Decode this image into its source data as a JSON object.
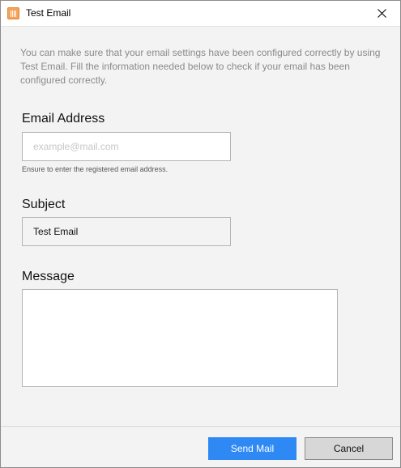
{
  "window": {
    "title": "Test Email",
    "close_icon": "close-icon"
  },
  "intro_text": "You can make sure that your email settings have been configured correctly by using Test Email. Fill the information needed below to check if your email has been configured correctly.",
  "email": {
    "label": "Email Address",
    "value": "",
    "placeholder": "example@mail.com",
    "hint": "Ensure to enter the registered email address."
  },
  "subject": {
    "label": "Subject",
    "value": "Test Email"
  },
  "message": {
    "label": "Message",
    "value": ""
  },
  "buttons": {
    "send_label": "Send Mail",
    "cancel_label": "Cancel"
  },
  "colors": {
    "accent": "#2f89f5",
    "app_icon": "#f4a259"
  }
}
